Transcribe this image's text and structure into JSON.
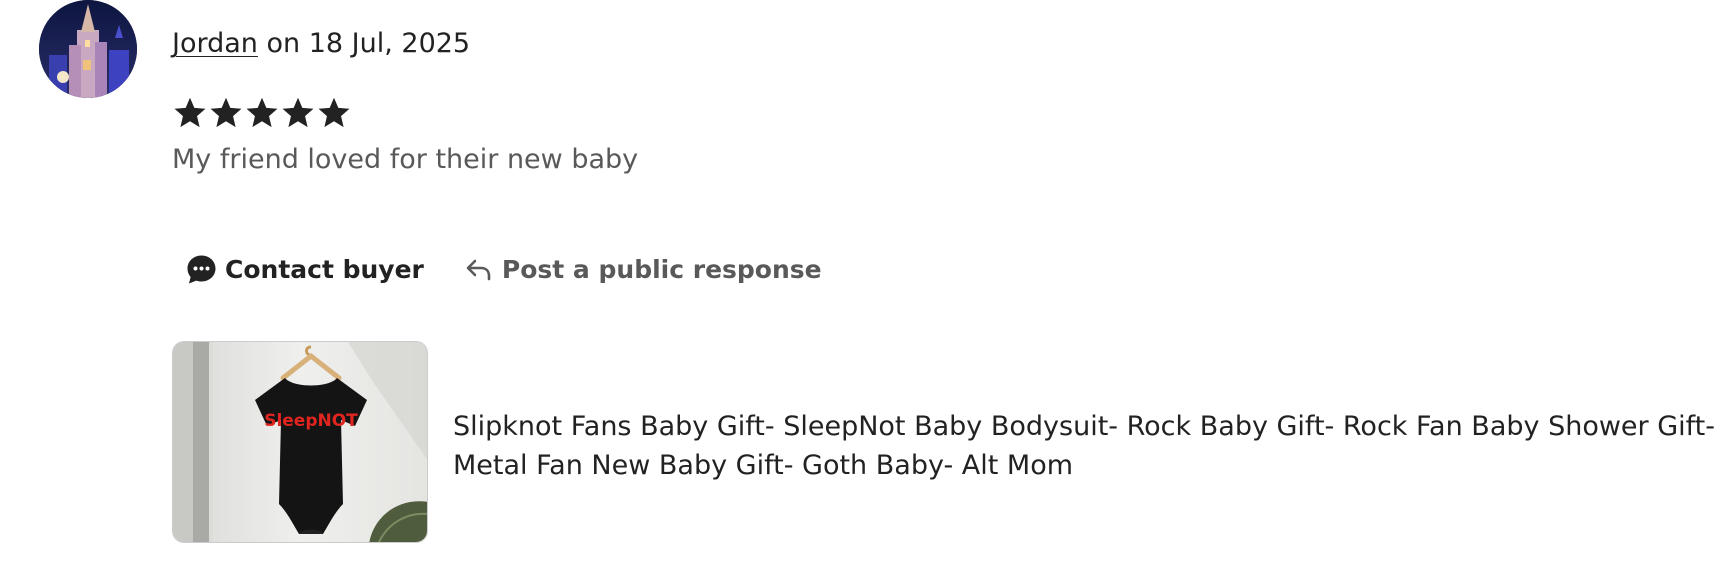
{
  "review": {
    "reviewer_name": "Jordan",
    "date_text": "on 18 Jul, 2025",
    "rating": 5,
    "rating_max": 5,
    "text": "My friend loved for their new baby"
  },
  "actions": {
    "contact_label": "Contact buyer",
    "respond_label": "Post a public response"
  },
  "listing": {
    "title": "Slipknot Fans Baby Gift- SleepNot Baby Bodysuit- Rock Baby Gift- Rock Fan Baby Shower Gift- Metal Fan New Baby Gift- Goth Baby- Alt Mom",
    "image_text": "SleepNOT"
  },
  "icons": {
    "star": "star-icon",
    "contact": "chat-bubble-icon",
    "respond": "reply-arrow-icon"
  },
  "colors": {
    "text_primary": "#222222",
    "text_secondary": "#595959",
    "star": "#222222",
    "print_red": "#e0241f"
  }
}
